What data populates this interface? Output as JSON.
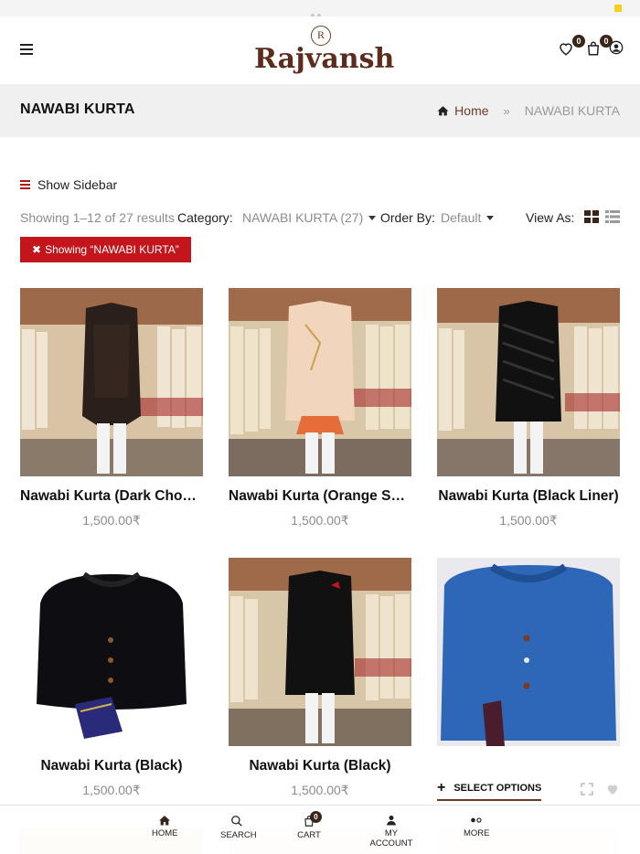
{
  "header": {
    "logo_monogram": "R",
    "logo_text": "Rajvansh",
    "wishlist_count": "0",
    "cart_count": "0"
  },
  "title_band": {
    "title": "NAWABI KURTA",
    "breadcrumb_home": "Home",
    "breadcrumb_separator": "»",
    "breadcrumb_current": "NAWABI KURTA"
  },
  "toolbar": {
    "sidebar_label": "Show Sidebar",
    "results": "Showing 1–12 of 27 results",
    "category_label": "Category:",
    "category_value": "NAWABI KURTA (27)",
    "order_label": "Order By:",
    "order_value": "Default",
    "view_as_label": "View As:"
  },
  "active_filter": {
    "x": "✖",
    "label": "Showing “NAWABI KURTA”"
  },
  "products": [
    {
      "name": "Nawabi Kurta (Dark Chocolate)",
      "price": "1,500.00",
      "currency": "₹"
    },
    {
      "name": "Nawabi Kurta (Orange Shade)",
      "price": "1,500.00",
      "currency": "₹"
    },
    {
      "name": "Nawabi Kurta (Black Liner)",
      "price": "1,500.00",
      "currency": "₹"
    },
    {
      "name": "Nawabi Kurta (Black)",
      "price": "1,500.00",
      "currency": "₹"
    },
    {
      "name": "Nawabi Kurta (Black)",
      "price": "1,500.00",
      "currency": "₹"
    },
    {
      "select_options": "SELECT OPTIONS"
    }
  ],
  "bottom_nav": {
    "home": "HOME",
    "search": "SEARCH",
    "cart": "CART",
    "cart_count": "0",
    "account": "MY ACCOUNT",
    "more": "MORE"
  },
  "colors": {
    "brand": "#5c2c1d",
    "accent_red": "#c4151c",
    "muted_text": "#8c8c8c"
  }
}
